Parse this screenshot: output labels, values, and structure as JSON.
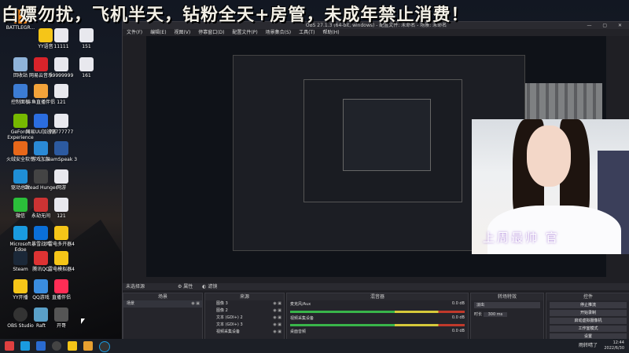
{
  "banner": "白嫖勿扰，飞机半天，钻粉全天+房管，未成年禁止消费！",
  "desktop_icons": [
    {
      "label": "BATTLEGR..."
    },
    {
      "label": "回收站"
    },
    {
      "label": "网易云音乐"
    },
    {
      "label": "控制面板"
    },
    {
      "label": "斗鱼直播伴侣"
    },
    {
      "label": "GeForce Experience"
    },
    {
      "label": "网易UU加速器"
    },
    {
      "label": "火绒安全软件"
    },
    {
      "label": "游戏加加"
    },
    {
      "label": "驱动总裁"
    },
    {
      "label": "Dread Hunger"
    },
    {
      "label": "微信"
    },
    {
      "label": "永劫无间"
    },
    {
      "label": "Microsoft Edge"
    },
    {
      "label": "暴雪战网"
    },
    {
      "label": "Steam"
    },
    {
      "label": "腾讯QQ"
    },
    {
      "label": "YY开播"
    },
    {
      "label": "QQ游戏"
    },
    {
      "label": "OBS Studio"
    },
    {
      "label": "Raft"
    },
    {
      "label": "YY语音"
    },
    {
      "label": "11111"
    },
    {
      "label": "151"
    },
    {
      "label": "99999999"
    },
    {
      "label": "161"
    },
    {
      "label": "121"
    },
    {
      "label": "77777777"
    },
    {
      "label": "TeamSpeak 3"
    },
    {
      "label": "网游"
    },
    {
      "label": "121"
    },
    {
      "label": "雷电多开器4"
    },
    {
      "label": "雷电模拟器4"
    },
    {
      "label": "直播伴侣"
    },
    {
      "label": "开哥"
    }
  ],
  "obs": {
    "title": "OBS 27.1.3 (64-bit, windows) - 配置文件: 未命名 - 场景: 未命名",
    "menu": [
      "文件(F)",
      "编辑(E)",
      "视图(V)",
      "停靠窗口(D)",
      "配置文件(P)",
      "场景集合(S)",
      "工具(T)",
      "帮助(H)"
    ],
    "no_source": "未选择源",
    "props_label": "属性",
    "filters_label": "滤镜",
    "panels": {
      "scenes": "场景",
      "sources": "来源",
      "mixer": "混音器",
      "transitions": "转场特效",
      "controls": "控件"
    },
    "scene_item": "场景",
    "sources": [
      "图像 3",
      "图像 2",
      "文本 (GDI+) 2",
      "文本 (GDI+) 3",
      "视频采集设备",
      "文本 (GDI+)"
    ],
    "mixer_items": [
      {
        "name": "麦克风/Aux",
        "db": "0.0 dB"
      },
      {
        "name": "视频采集设备",
        "db": "0.0 dB"
      },
      {
        "name": "桌面音频",
        "db": "0.0 dB"
      }
    ],
    "transition": "淡出",
    "duration_label": "时长",
    "duration": "300 ms",
    "controls": [
      "停止推流",
      "开始录制",
      "启动虚拟摄像机",
      "工作室模式",
      "设置",
      "退出"
    ]
  },
  "webcam_text": "上周最帅 官",
  "taskbar": {
    "tray_text": "雨转晴了",
    "time": "12:44",
    "date": "2022/6/30"
  },
  "colors": {
    "accent": "#39b54a",
    "meter_yellow": "#d6c93a",
    "meter_red": "#c0392b"
  }
}
